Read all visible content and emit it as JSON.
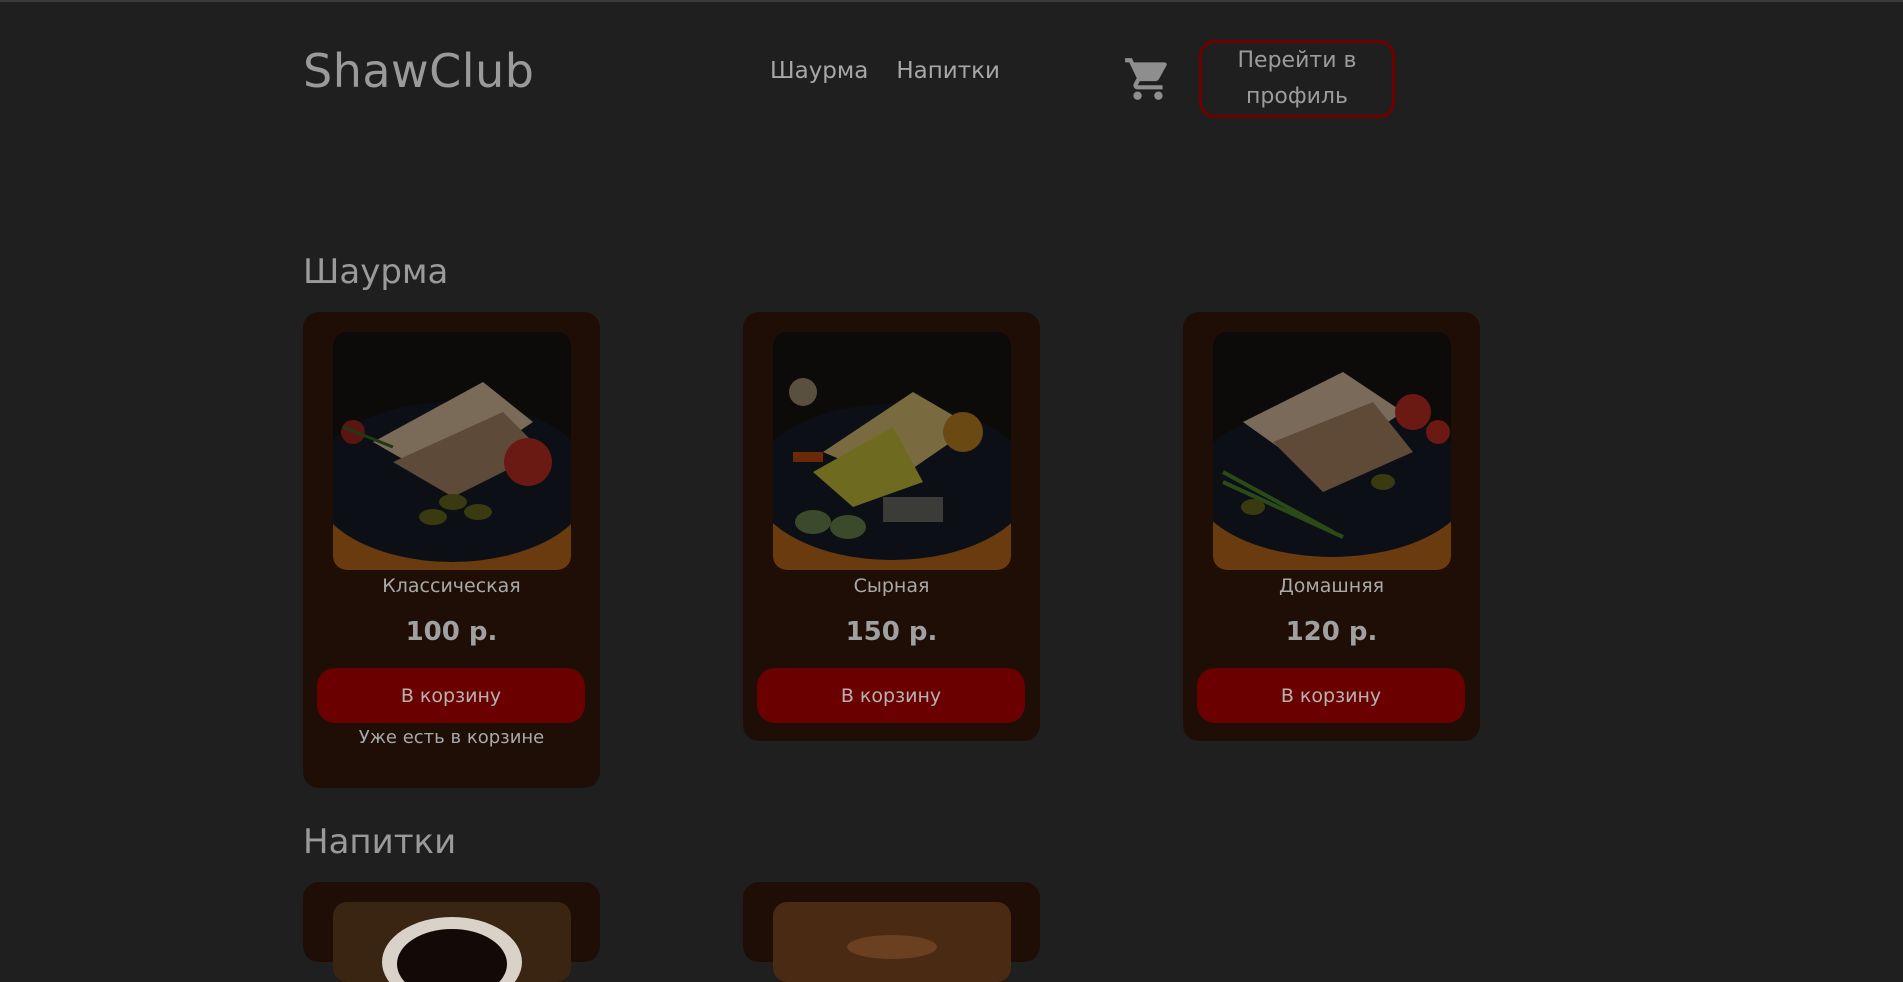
{
  "header": {
    "logo": "ShawClub",
    "nav": [
      "Шаурма",
      "Напитки"
    ],
    "cart_icon": "cart-icon",
    "profile_button": "Перейти в профиль"
  },
  "sections": [
    {
      "title": "Шаурма",
      "items": [
        {
          "name": "Классическая",
          "price": "100 р.",
          "button": "В корзину",
          "note": "Уже есть в корзине"
        },
        {
          "name": "Сырная",
          "price": "150 р.",
          "button": "В корзину"
        },
        {
          "name": "Домашняя",
          "price": "120 р.",
          "button": "В корзину"
        }
      ]
    },
    {
      "title": "Напитки",
      "items": [
        {},
        {}
      ]
    }
  ],
  "colors": {
    "background": "#1f1f1f",
    "card": "#1e0e06",
    "accent": "#6b0000"
  }
}
